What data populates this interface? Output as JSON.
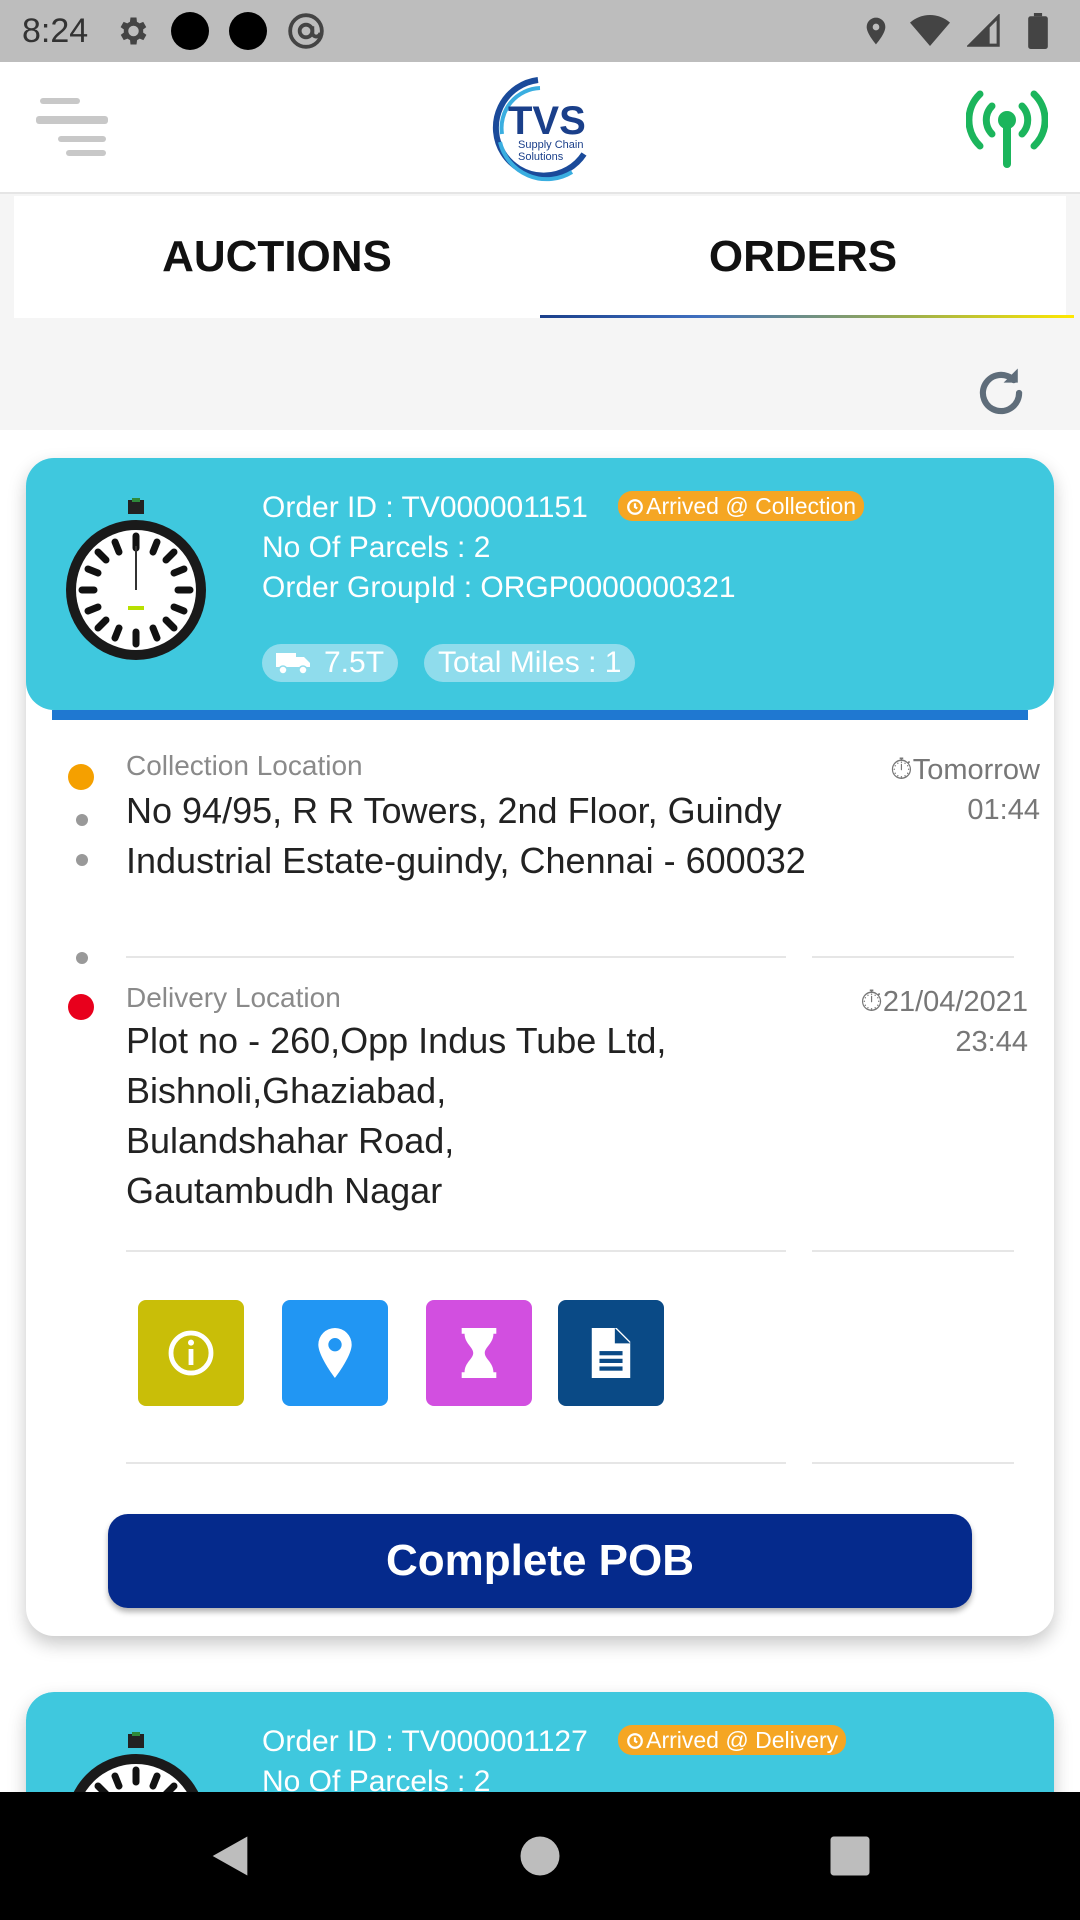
{
  "status_bar": {
    "time": "8:24",
    "left_icons": [
      "gear-icon",
      "circle-icon",
      "circle-icon",
      "at-sign-icon"
    ],
    "right_icons": [
      "location-icon",
      "wifi-icon",
      "cell-signal-icon",
      "battery-icon"
    ]
  },
  "app_bar": {
    "logo_main": "TVS",
    "logo_sub_1": "Supply Chain",
    "logo_sub_2": "Solutions",
    "signal_color": "#1bb55c"
  },
  "tabs": [
    {
      "label": "AUCTIONS",
      "active": false
    },
    {
      "label": "ORDERS",
      "active": true
    }
  ],
  "orders": [
    {
      "order_id": "Order ID : TV000001151",
      "status": "Arrived @ Collection",
      "parcels": "No Of Parcels : 2",
      "group_id": "Order GroupId : ORGP0000000321",
      "vehicle": "7.5T",
      "miles": "Total Miles : 1",
      "collection": {
        "label": "Collection Location",
        "address": "No 94/95, R R Towers, 2nd Floor, Guindy Industrial Estate-guindy, Chennai - 600032",
        "time_day": "Tomorrow",
        "time_clock": "01:44"
      },
      "delivery": {
        "label": "Delivery Location",
        "address_lines": [
          "Plot no - 260,Opp Indus Tube Ltd,",
          "Bishnoli,Ghaziabad,",
          "Bulandshahar Road,",
          "Gautambudh Nagar"
        ],
        "time_day": "21/04/2021",
        "time_clock": "23:44"
      },
      "actions": [
        {
          "name": "info",
          "color": "#c9be08"
        },
        {
          "name": "location",
          "color": "#2196f3"
        },
        {
          "name": "hourglass",
          "color": "#d24fe0"
        },
        {
          "name": "document",
          "color": "#0a4a86"
        }
      ],
      "complete_label": "Complete POB"
    },
    {
      "order_id": "Order ID : TV000001127",
      "status": "Arrived @ Delivery",
      "parcels": "No Of Parcels : 2"
    }
  ],
  "colors": {
    "card_header": "#3fc8de",
    "status_pill": "#f5a623",
    "primary_button": "#052a8c"
  }
}
